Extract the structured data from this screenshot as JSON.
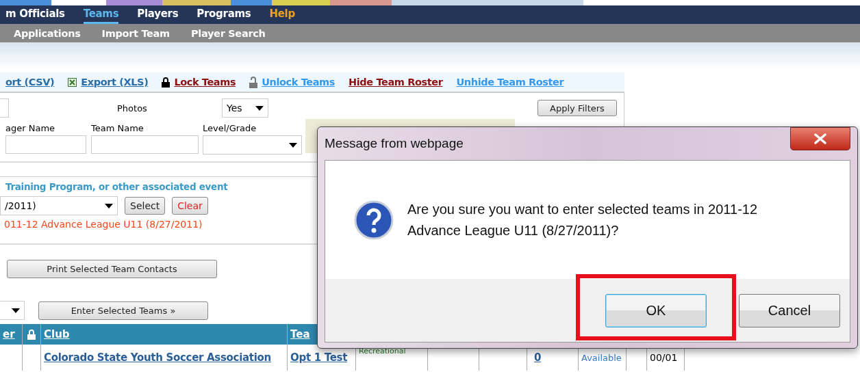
{
  "nav": {
    "items": [
      {
        "label": "m Officials",
        "selected": false,
        "kind": "link"
      },
      {
        "label": "Teams",
        "selected": true,
        "kind": "link"
      },
      {
        "label": "Players",
        "selected": false,
        "kind": "link"
      },
      {
        "label": "Programs",
        "selected": false,
        "kind": "link"
      },
      {
        "label": "Help",
        "selected": false,
        "kind": "help"
      }
    ]
  },
  "subnav": {
    "items": [
      "Applications",
      "Import Team",
      "Player Search"
    ]
  },
  "toolbar": {
    "links": [
      {
        "label": "ort (CSV)",
        "kind": "plain",
        "color": "#2a6ea8"
      },
      {
        "label": "Export (XLS)",
        "kind": "excel",
        "color": "#2a6ea8"
      },
      {
        "label": "Lock Teams",
        "kind": "lock",
        "color": "#8b1010"
      },
      {
        "label": "Unlock Teams",
        "kind": "unlock",
        "color": "#3399ee"
      },
      {
        "label": "Hide Team Roster",
        "kind": "plain",
        "color": "#8b1010"
      },
      {
        "label": "Unhide Team Roster",
        "kind": "plain",
        "color": "#3399ee"
      }
    ]
  },
  "filters": {
    "photos_label": "Photos",
    "photos_value": "Yes",
    "apply_button": "Apply Filters",
    "fields": [
      {
        "label": "ager Name",
        "kind": "text"
      },
      {
        "label": "Team Name",
        "kind": "text"
      },
      {
        "label": "Level/Grade",
        "kind": "select"
      }
    ]
  },
  "event": {
    "heading": "Training Program, or other associated event",
    "select_value": "/2011)",
    "select_button": "Select",
    "clear_button": "Clear",
    "current": "011-12 Advance League U11 (8/27/2011)"
  },
  "print_button": "Print Selected Team Contacts",
  "enter_button": "Enter Selected Teams »",
  "table": {
    "columns": [
      "er",
      "",
      "Club",
      "Tea"
    ],
    "rows": [
      {
        "club": "Colorado State Youth Soccer Association",
        "team": "Opt 1 Test",
        "level": "Recreational",
        "count": "0",
        "status": "Available",
        "code": "00/01"
      }
    ]
  },
  "dialog": {
    "title": "Message from webpage",
    "message": "Are you sure you want to enter selected teams in 2011-12 Advance League U11 (8/27/2011)?",
    "buttons": [
      {
        "label": "OK",
        "highlighted": true
      },
      {
        "label": "Cancel",
        "highlighted": false
      }
    ]
  }
}
